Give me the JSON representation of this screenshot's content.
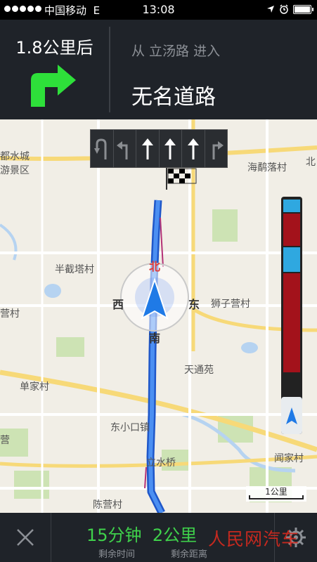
{
  "status_bar": {
    "carrier": "中国移动",
    "network": "E",
    "time": "13:08"
  },
  "guidance": {
    "distance": "1.8公里后",
    "maneuver_icon": "turn-right-icon",
    "from_road": "从 立汤路 进入",
    "next_road": "无名道路"
  },
  "lanes": [
    "u-turn-icon",
    "turn-left-icon",
    "straight-icon",
    "straight-icon",
    "straight-icon",
    "turn-right-icon"
  ],
  "map": {
    "places": [
      "都水城",
      "游景区",
      "海鹬落村",
      "北",
      "半截塔村",
      "营村",
      "狮子营村",
      "天通苑",
      "单家村",
      "东小口镇",
      "立水桥",
      "闻家村",
      "陈营村",
      "营"
    ],
    "compass": {
      "north": "北",
      "east": "东",
      "south": "南",
      "west": "西"
    },
    "scale": "1公里"
  },
  "traffic_progress": {
    "segments": [
      {
        "status": "clear",
        "color": "#2fa8e0",
        "fraction": 0.07
      },
      {
        "status": "congested",
        "color": "#a3121b",
        "fraction": 0.17
      },
      {
        "status": "clear",
        "color": "#2fa8e0",
        "fraction": 0.13
      },
      {
        "status": "congested",
        "color": "#a3121b",
        "fraction": 0.5
      }
    ]
  },
  "bottom": {
    "time_value": "15分钟",
    "distance_value": "2公里",
    "time_label": "剩余时间",
    "distance_label": "剩余距离"
  },
  "watermark": "人民网汽车"
}
